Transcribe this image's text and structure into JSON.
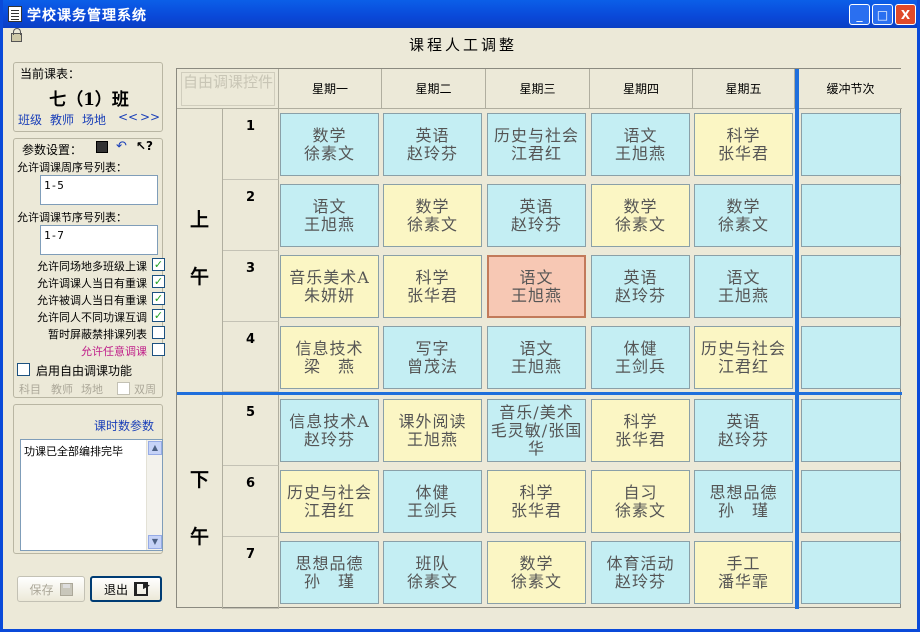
{
  "window": {
    "title": "学校课务管理系统",
    "heading": "课程人工调整",
    "controls": [
      "_",
      "□",
      "X"
    ]
  },
  "left": {
    "current": {
      "label": "当前课表：",
      "class_name": "七（1）班",
      "links": [
        "班级",
        "教师",
        "场地",
        "<<",
        ">>"
      ]
    },
    "params": {
      "label": "参数设置：",
      "week_label": "允许调课周序号列表：",
      "week_value": "1-5",
      "period_label": "允许调课节序号列表：",
      "period_value": "1-7",
      "options": [
        {
          "label": "允许同场地多班级上课",
          "checked": true
        },
        {
          "label": "允许调课人当日有重课",
          "checked": true
        },
        {
          "label": "允许被调人当日有重课",
          "checked": true
        },
        {
          "label": "允许同人不同功课互调",
          "checked": true
        },
        {
          "label": "暂时屏蔽禁排课列表",
          "checked": false
        },
        {
          "label": "允许任意调课",
          "checked": false,
          "color": "#c0208a"
        }
      ],
      "free_enable": "启用自由调课功能",
      "free_sub": [
        "科目",
        "教师",
        "场地"
      ],
      "biweek": "双周"
    },
    "hours": {
      "label": "课时数参数",
      "memo": "功课已全部编排完毕"
    },
    "buttons": {
      "save": "保存",
      "exit": "退出"
    }
  },
  "grid": {
    "free_button": "自由调课控件",
    "days": [
      "星期一",
      "星期二",
      "星期三",
      "星期四",
      "星期五"
    ],
    "buffer_label": "缓冲节次",
    "morning": [
      "上",
      "午"
    ],
    "afternoon": [
      "下",
      "午"
    ],
    "periods": [
      "1",
      "2",
      "3",
      "4",
      "5",
      "6",
      "7"
    ],
    "rows": [
      [
        {
          "subject": "数学",
          "teacher": "徐素文",
          "color": "c"
        },
        {
          "subject": "英语",
          "teacher": "赵玲芬",
          "color": "c"
        },
        {
          "subject": "历史与社会",
          "teacher": "江君红",
          "color": "c"
        },
        {
          "subject": "语文",
          "teacher": "王旭燕",
          "color": "c"
        },
        {
          "subject": "科学",
          "teacher": "张华君",
          "color": "y"
        }
      ],
      [
        {
          "subject": "语文",
          "teacher": "王旭燕",
          "color": "c"
        },
        {
          "subject": "数学",
          "teacher": "徐素文",
          "color": "y"
        },
        {
          "subject": "英语",
          "teacher": "赵玲芬",
          "color": "c"
        },
        {
          "subject": "数学",
          "teacher": "徐素文",
          "color": "y"
        },
        {
          "subject": "数学",
          "teacher": "徐素文",
          "color": "c"
        }
      ],
      [
        {
          "subject": "音乐美术A",
          "teacher": "朱妍妍",
          "color": "y"
        },
        {
          "subject": "科学",
          "teacher": "张华君",
          "color": "y"
        },
        {
          "subject": "语文",
          "teacher": "王旭燕",
          "color": "sel"
        },
        {
          "subject": "英语",
          "teacher": "赵玲芬",
          "color": "c"
        },
        {
          "subject": "语文",
          "teacher": "王旭燕",
          "color": "c"
        }
      ],
      [
        {
          "subject": "信息技术",
          "teacher": "梁　燕",
          "color": "y"
        },
        {
          "subject": "写字",
          "teacher": "曾茂法",
          "color": "c"
        },
        {
          "subject": "语文",
          "teacher": "王旭燕",
          "color": "c"
        },
        {
          "subject": "体健",
          "teacher": "王剑兵",
          "color": "c"
        },
        {
          "subject": "历史与社会",
          "teacher": "江君红",
          "color": "y"
        }
      ],
      [
        {
          "subject": "信息技术A",
          "teacher": "赵玲芬",
          "color": "c"
        },
        {
          "subject": "课外阅读",
          "teacher": "王旭燕",
          "color": "y"
        },
        {
          "subject": "音乐/美术",
          "teacher": "毛灵敏/张国华",
          "color": "c"
        },
        {
          "subject": "科学",
          "teacher": "张华君",
          "color": "y"
        },
        {
          "subject": "英语",
          "teacher": "赵玲芬",
          "color": "c"
        }
      ],
      [
        {
          "subject": "历史与社会",
          "teacher": "江君红",
          "color": "y"
        },
        {
          "subject": "体健",
          "teacher": "王剑兵",
          "color": "c"
        },
        {
          "subject": "科学",
          "teacher": "张华君",
          "color": "y"
        },
        {
          "subject": "自习",
          "teacher": "徐素文",
          "color": "y"
        },
        {
          "subject": "思想品德",
          "teacher": "孙　瑾",
          "color": "c"
        }
      ],
      [
        {
          "subject": "思想品德",
          "teacher": "孙　瑾",
          "color": "c"
        },
        {
          "subject": "班队",
          "teacher": "徐素文",
          "color": "c"
        },
        {
          "subject": "数学",
          "teacher": "徐素文",
          "color": "y"
        },
        {
          "subject": "体育活动",
          "teacher": "赵玲芬",
          "color": "c"
        },
        {
          "subject": "手工",
          "teacher": "潘华霏",
          "color": "y"
        }
      ]
    ]
  }
}
